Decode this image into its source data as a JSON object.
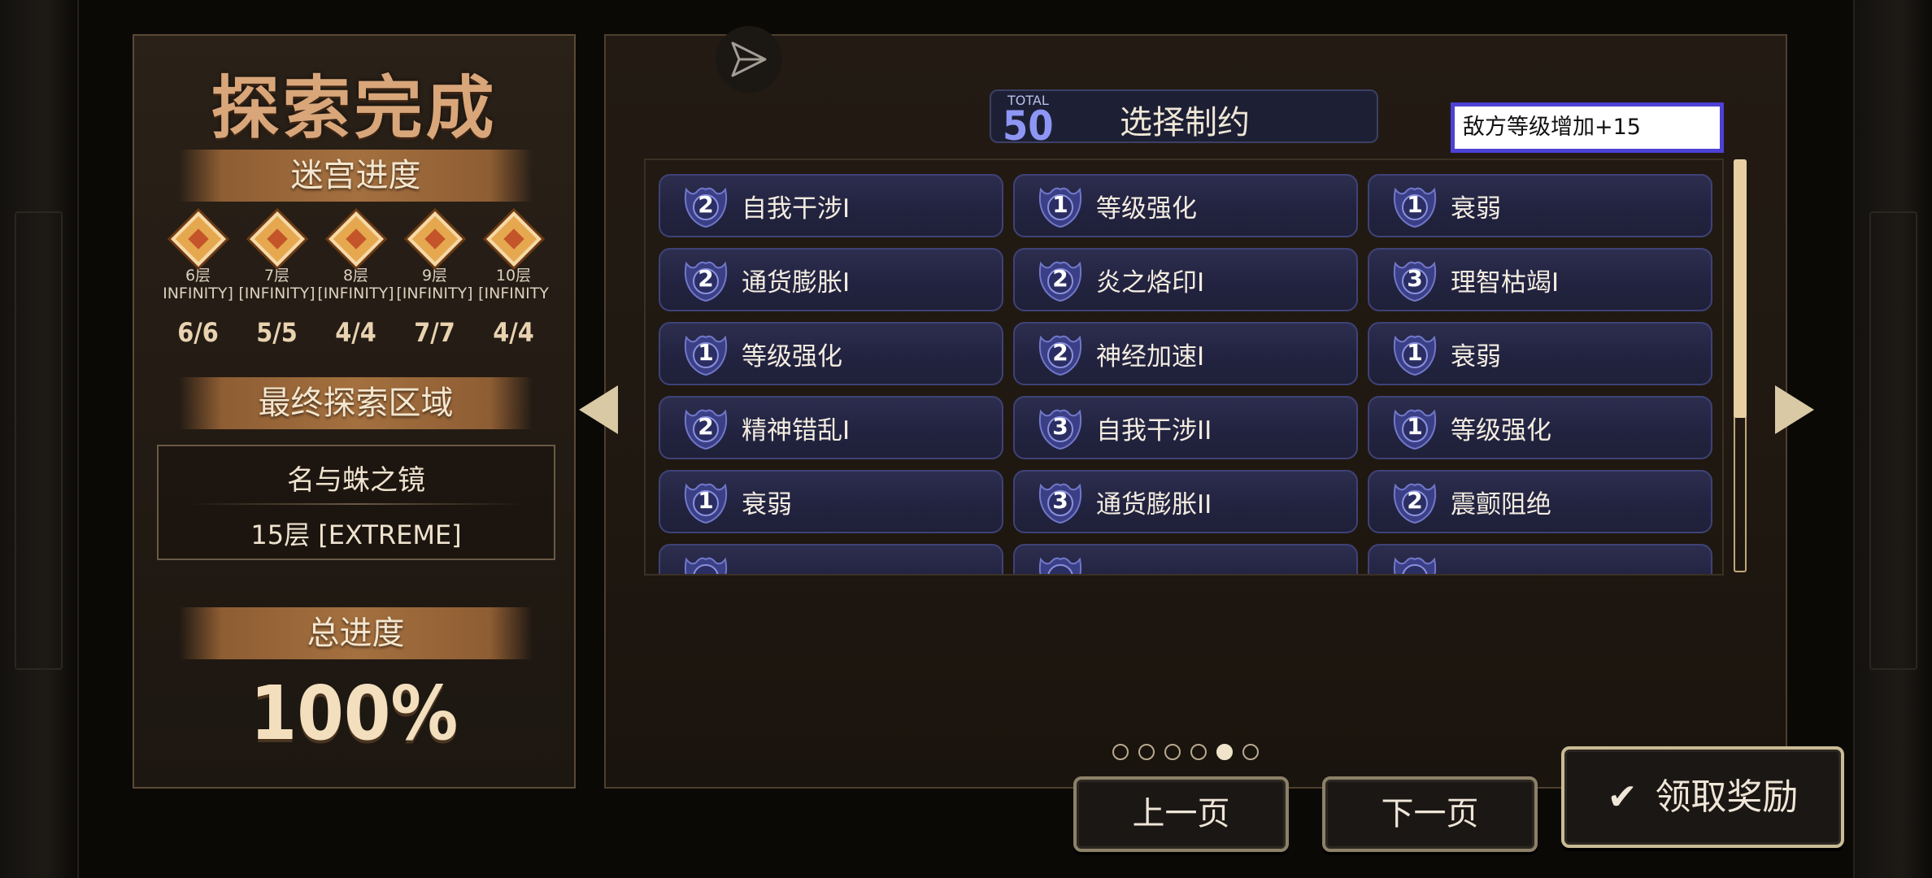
{
  "left_panel": {
    "title": "探索完成",
    "maze_progress_label": "迷宫进度",
    "floors": [
      {
        "name": "6层",
        "mode": "INFINITY]",
        "count": "6/6"
      },
      {
        "name": "7层",
        "mode": "[INFINITY]",
        "count": "5/5"
      },
      {
        "name": "8层",
        "mode": "[INFINITY]",
        "count": "4/4"
      },
      {
        "name": "9层",
        "mode": "[INFINITY]",
        "count": "7/7"
      },
      {
        "name": "10层",
        "mode": "[INFINITY",
        "count": "4/4"
      }
    ],
    "final_area_label": "最终探索区域",
    "area_name": "名与蛛之镜",
    "area_level": "15层 [EXTREME]",
    "total_progress_label": "总进度",
    "total_progress_value": "100%"
  },
  "main_panel": {
    "total_label": "TOTAL",
    "total_value": "50",
    "header_title": "选择制约",
    "effect_text": "敌方等级增加+15",
    "constraints": [
      {
        "level": "2",
        "label": "自我干涉I"
      },
      {
        "level": "1",
        "label": "等级强化"
      },
      {
        "level": "1",
        "label": "衰弱"
      },
      {
        "level": "2",
        "label": "通货膨胀I"
      },
      {
        "level": "2",
        "label": "炎之烙印I"
      },
      {
        "level": "3",
        "label": "理智枯竭I"
      },
      {
        "level": "1",
        "label": "等级强化"
      },
      {
        "level": "2",
        "label": "神经加速I"
      },
      {
        "level": "1",
        "label": "衰弱"
      },
      {
        "level": "2",
        "label": "精神错乱I"
      },
      {
        "level": "3",
        "label": "自我干涉II"
      },
      {
        "level": "1",
        "label": "等级强化"
      },
      {
        "level": "1",
        "label": "衰弱"
      },
      {
        "level": "3",
        "label": "通货膨胀II"
      },
      {
        "level": "2",
        "label": "震颤阻绝"
      }
    ],
    "page_dots": 6,
    "active_page": 5
  },
  "buttons": {
    "prev": "上一页",
    "next": "下一页",
    "claim": "领取奖励"
  },
  "colors": {
    "accent_gold": "#d9a67a",
    "cell_bg": "#24253f",
    "highlight_border": "#4d41d6"
  }
}
